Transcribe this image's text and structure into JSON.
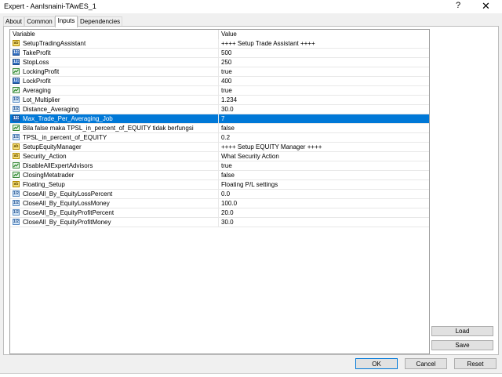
{
  "window": {
    "title": "Expert - AanIsnaini-TAwES_1",
    "help_glyph": "?",
    "close_glyph": "✕"
  },
  "tabs": [
    {
      "label": "About",
      "active": false
    },
    {
      "label": "Common",
      "active": false
    },
    {
      "label": "Inputs",
      "active": true
    },
    {
      "label": "Dependencies",
      "active": false
    }
  ],
  "grid": {
    "headers": {
      "variable": "Variable",
      "value": "Value"
    },
    "selected_row": 8,
    "rows": [
      {
        "type": "string",
        "icon": "string-type-icon",
        "variable": "SetupTradingAssistant",
        "value": "++++ Setup Trade Assistant ++++"
      },
      {
        "type": "int",
        "icon": "integer-type-icon",
        "variable": "TakeProfit",
        "value": "500"
      },
      {
        "type": "int",
        "icon": "integer-type-icon",
        "variable": "StopLoss",
        "value": "250"
      },
      {
        "type": "bool",
        "icon": "boolean-type-icon",
        "variable": "LockingProfit",
        "value": "true"
      },
      {
        "type": "int",
        "icon": "integer-type-icon",
        "variable": "LockProfit",
        "value": "400"
      },
      {
        "type": "bool",
        "icon": "boolean-type-icon",
        "variable": "Averaging",
        "value": "true"
      },
      {
        "type": "double",
        "icon": "double-type-icon",
        "variable": "Lot_Multiplier",
        "value": "1.234"
      },
      {
        "type": "double",
        "icon": "double-type-icon",
        "variable": "Distance_Averaging",
        "value": "30.0"
      },
      {
        "type": "int",
        "icon": "integer-type-icon",
        "variable": "Max_Trade_Per_Averaging_Job",
        "value": "7"
      },
      {
        "type": "bool",
        "icon": "boolean-type-icon",
        "variable": "Bila false maka TPSL_in_percent_of_EQUITY  tidak berfungsi",
        "value": "false"
      },
      {
        "type": "double",
        "icon": "double-type-icon",
        "variable": "TPSL_in_percent_of_EQUITY",
        "value": "0.2"
      },
      {
        "type": "string",
        "icon": "string-type-icon",
        "variable": "SetupEquityManager",
        "value": "++++ Setup EQUITY Manager ++++"
      },
      {
        "type": "string",
        "icon": "string-type-icon",
        "variable": "Security_Action",
        "value": "What Security Action"
      },
      {
        "type": "bool",
        "icon": "boolean-type-icon",
        "variable": "DisableAllExpertAdvisors",
        "value": "true"
      },
      {
        "type": "bool",
        "icon": "boolean-type-icon",
        "variable": "ClosingMetatrader",
        "value": "false"
      },
      {
        "type": "string",
        "icon": "string-type-icon",
        "variable": "Floating_Setup",
        "value": "Floating P/L settings"
      },
      {
        "type": "double",
        "icon": "double-type-icon",
        "variable": "CloseAll_By_EquityLossPercent",
        "value": "0.0"
      },
      {
        "type": "double",
        "icon": "double-type-icon",
        "variable": "CloseAll_By_EquityLossMoney",
        "value": "100.0"
      },
      {
        "type": "double",
        "icon": "double-type-icon",
        "variable": "CloseAll_By_EquityProfitPercent",
        "value": "20.0"
      },
      {
        "type": "double",
        "icon": "double-type-icon",
        "variable": "CloseAll_By_EquityProfitMoney",
        "value": "30.0"
      }
    ]
  },
  "side_buttons": {
    "load": "Load",
    "save": "Save"
  },
  "footer_buttons": {
    "ok": "OK",
    "cancel": "Cancel",
    "reset": "Reset"
  },
  "colors": {
    "selection": "#0078d7",
    "ok_border": "#0078d7"
  }
}
